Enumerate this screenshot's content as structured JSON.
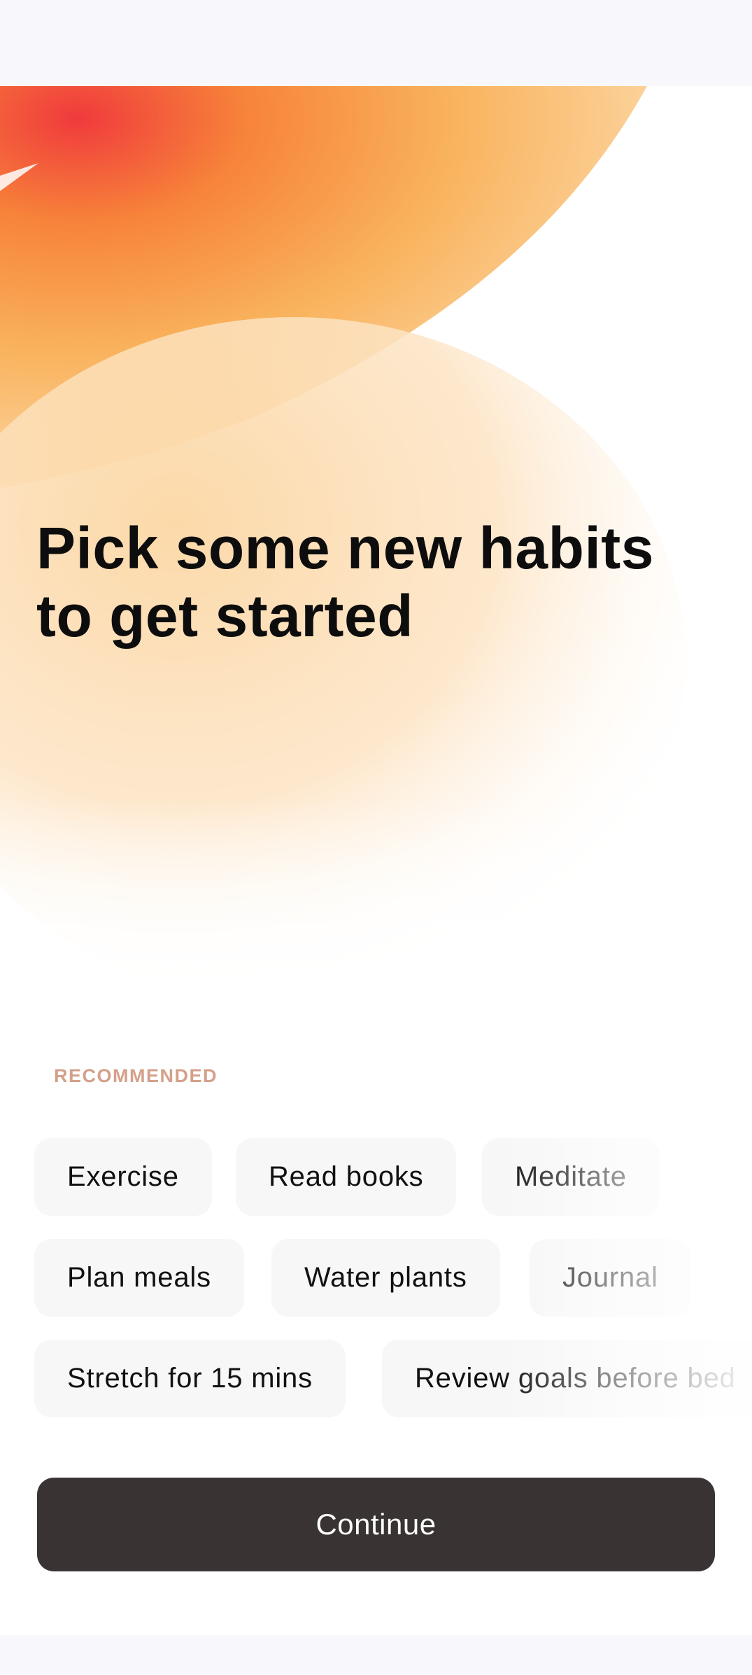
{
  "heading": "Pick some new habits to get started",
  "section_label": "RECOMMENDED",
  "habit_rows": [
    [
      "Exercise",
      "Read books",
      "Meditate"
    ],
    [
      "Plan meals",
      "Water plants",
      "Journal"
    ],
    [
      "Stretch for 15 mins",
      "Review goals before bed"
    ]
  ],
  "continue_label": "Continue",
  "colors": {
    "accent_red": "#f24a3c",
    "accent_orange": "#f7953a",
    "accent_peach": "#fbd39a",
    "button": "#393333",
    "section_label": "#d4a08a",
    "chip_background": "#f7f7f7"
  }
}
